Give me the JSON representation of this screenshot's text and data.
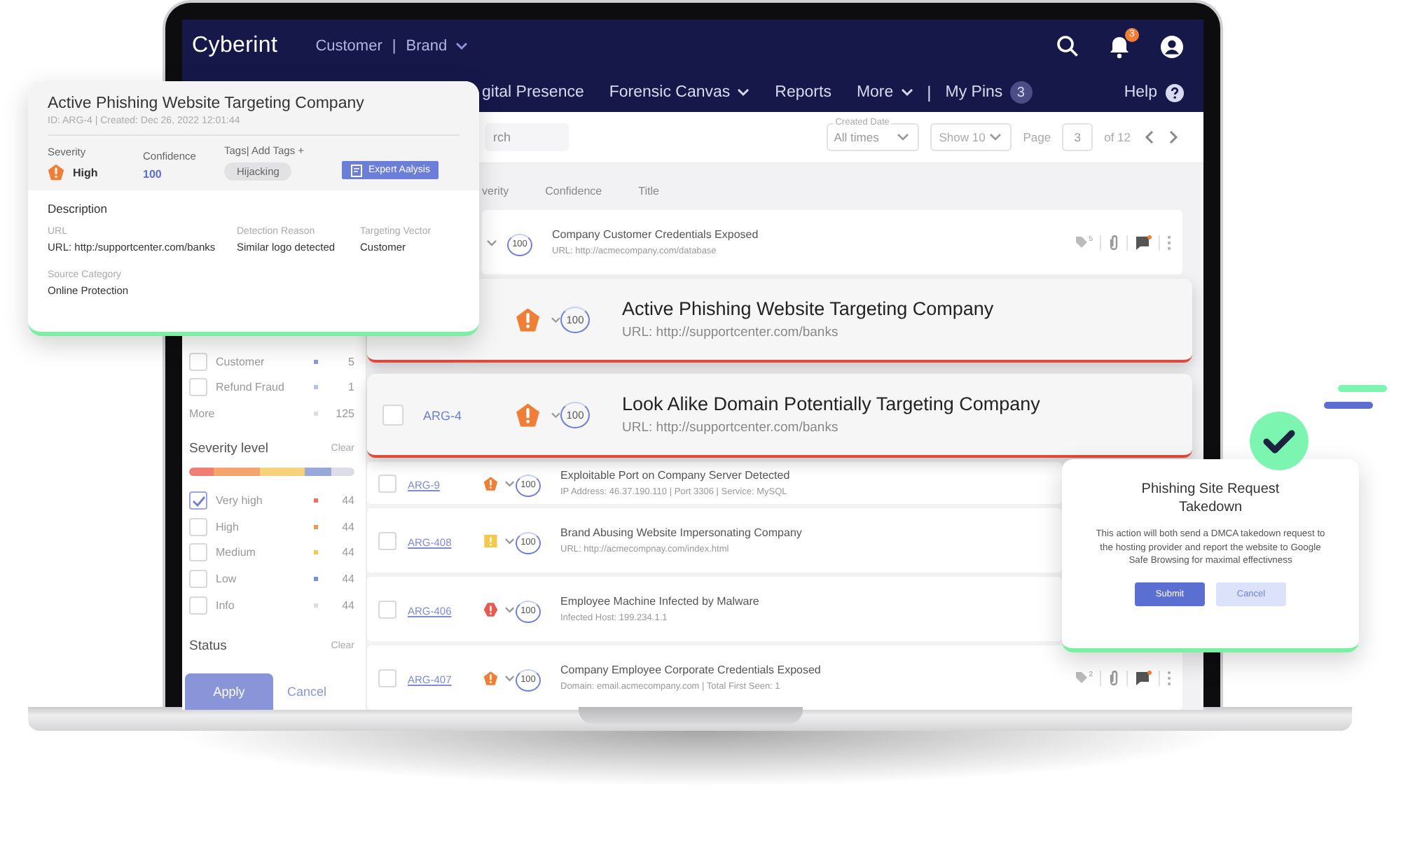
{
  "app": {
    "logo": "Cyberint",
    "account": "Customer",
    "separator": "|",
    "brand": "Brand",
    "notifications": "3"
  },
  "nav": [
    {
      "label": "gital Presence",
      "dropdown": false
    },
    {
      "label": "Forensic Canvas",
      "dropdown": true
    },
    {
      "label": "Reports",
      "dropdown": false
    },
    {
      "label": "More",
      "dropdown": true
    }
  ],
  "pins": {
    "label": "My Pins",
    "count": "3"
  },
  "help": "Help",
  "toolbar": {
    "search_placeholder": "rch",
    "date_legend": "Created Date",
    "date_value": "All times",
    "show": "Show 10",
    "page_label": "Page",
    "page": "3",
    "page_total": "of 12"
  },
  "filters": {
    "items": [
      {
        "label": "Customer",
        "color": "#8e9bd6",
        "count": "5",
        "checked": false
      },
      {
        "label": "Refund Fraud",
        "color": "#b9c0e8",
        "count": "1",
        "checked": false
      }
    ],
    "more": {
      "label": "More",
      "color": "#dcdde3",
      "count": "125"
    },
    "severity_title": "Severity level",
    "severity_clear": "Clear",
    "severity_items": [
      {
        "label": "Very high",
        "color": "#ef6f64",
        "count": "44",
        "checked": true
      },
      {
        "label": "High",
        "color": "#f4924f",
        "count": "44",
        "checked": false
      },
      {
        "label": "Medium",
        "color": "#f5c84c",
        "count": "44",
        "checked": false
      },
      {
        "label": "Low",
        "color": "#7c8fd6",
        "count": "44",
        "checked": false
      },
      {
        "label": "Info",
        "color": "#dcdde3",
        "count": "44",
        "checked": false
      }
    ],
    "status_title": "Status",
    "status_clear": "Clear",
    "apply": "Apply",
    "cancel": "Cancel"
  },
  "table": {
    "columns": [
      "verity",
      "Confidence",
      "Title"
    ],
    "rows": [
      {
        "kind": "normal",
        "partial": true,
        "confidence": "100",
        "title": "Company Customer Credentials Exposed",
        "subtitle": "URL: http://acmecompany.com/database",
        "tag_count": "5"
      },
      {
        "kind": "elevated",
        "severity": {
          "kind": "high"
        },
        "confidence": "100",
        "title": "Active Phishing Website Targeting Company",
        "subtitle": "URL: http://supportcenter.com/banks"
      },
      {
        "kind": "elevated",
        "checked": false,
        "id": "ARG-4",
        "severity": {
          "kind": "high"
        },
        "confidence": "100",
        "title": "Look Alike Domain Potentially Targeting Company",
        "subtitle": "URL: http://supportcenter.com/banks"
      },
      {
        "kind": "normal",
        "checked": false,
        "id": "ARG-9",
        "severity": {
          "kind": "high"
        },
        "confidence": "100",
        "title": "Exploitable Port on Company Server Detected",
        "subtitle": "IP Address: 46.37.190.110 | Port 3306 | Service: MySQL"
      },
      {
        "kind": "normal",
        "checked": false,
        "id": "ARG-408",
        "severity": {
          "kind": "medium"
        },
        "confidence": "100",
        "title": "Brand Abusing Website Impersonating Company",
        "subtitle": "URL: http://acmecompnay.com/index.html"
      },
      {
        "kind": "normal",
        "checked": false,
        "id": "ARG-406",
        "severity": {
          "kind": "very_high"
        },
        "confidence": "100",
        "title": "Employee Machine Infected by Malware",
        "subtitle": "Infected Host: 199.234.1.1"
      },
      {
        "kind": "normal",
        "checked": false,
        "id": "ARG-407",
        "severity": {
          "kind": "high"
        },
        "confidence": "100",
        "title": "Company Employee Corporate Credentials Exposed",
        "subtitle": "Domain: email.acmecompany.com | Total First Seen: 1",
        "tag_count": "2"
      }
    ]
  },
  "detail_card": {
    "title": "Active Phishing Website Targeting Company",
    "meta": "ID: ARG-4 | Created: Dec 26, 2022 12:01:44",
    "severity_label": "Severity",
    "severity": {
      "kind": "high"
    },
    "severity_value": "High",
    "confidence_label": "Confidence",
    "confidence": "100",
    "tags_label": "Tags| Add Tags +",
    "tags": [
      "Hijacking"
    ],
    "action": "Expert Aalysis",
    "description_title": "Description",
    "fields": [
      {
        "label": "URL",
        "value": "URL: http:/supportcenter.com/banks"
      },
      {
        "label": "Detection Reason",
        "value": "Similar logo detected"
      },
      {
        "label": "Targeting Vector",
        "value": "Customer"
      },
      {
        "label": "Source Category",
        "value": "Online Protection"
      }
    ]
  },
  "takedown_dialog": {
    "title": "Phishing Site Request Takedown",
    "body": "This action will both send a DMCA takedown request to the hosting provider and report the website to Google Safe Browsing for maximal effectivness",
    "buttons": [
      {
        "label": "Submit",
        "primary": true
      },
      {
        "label": "Cancel",
        "primary": false
      }
    ]
  }
}
